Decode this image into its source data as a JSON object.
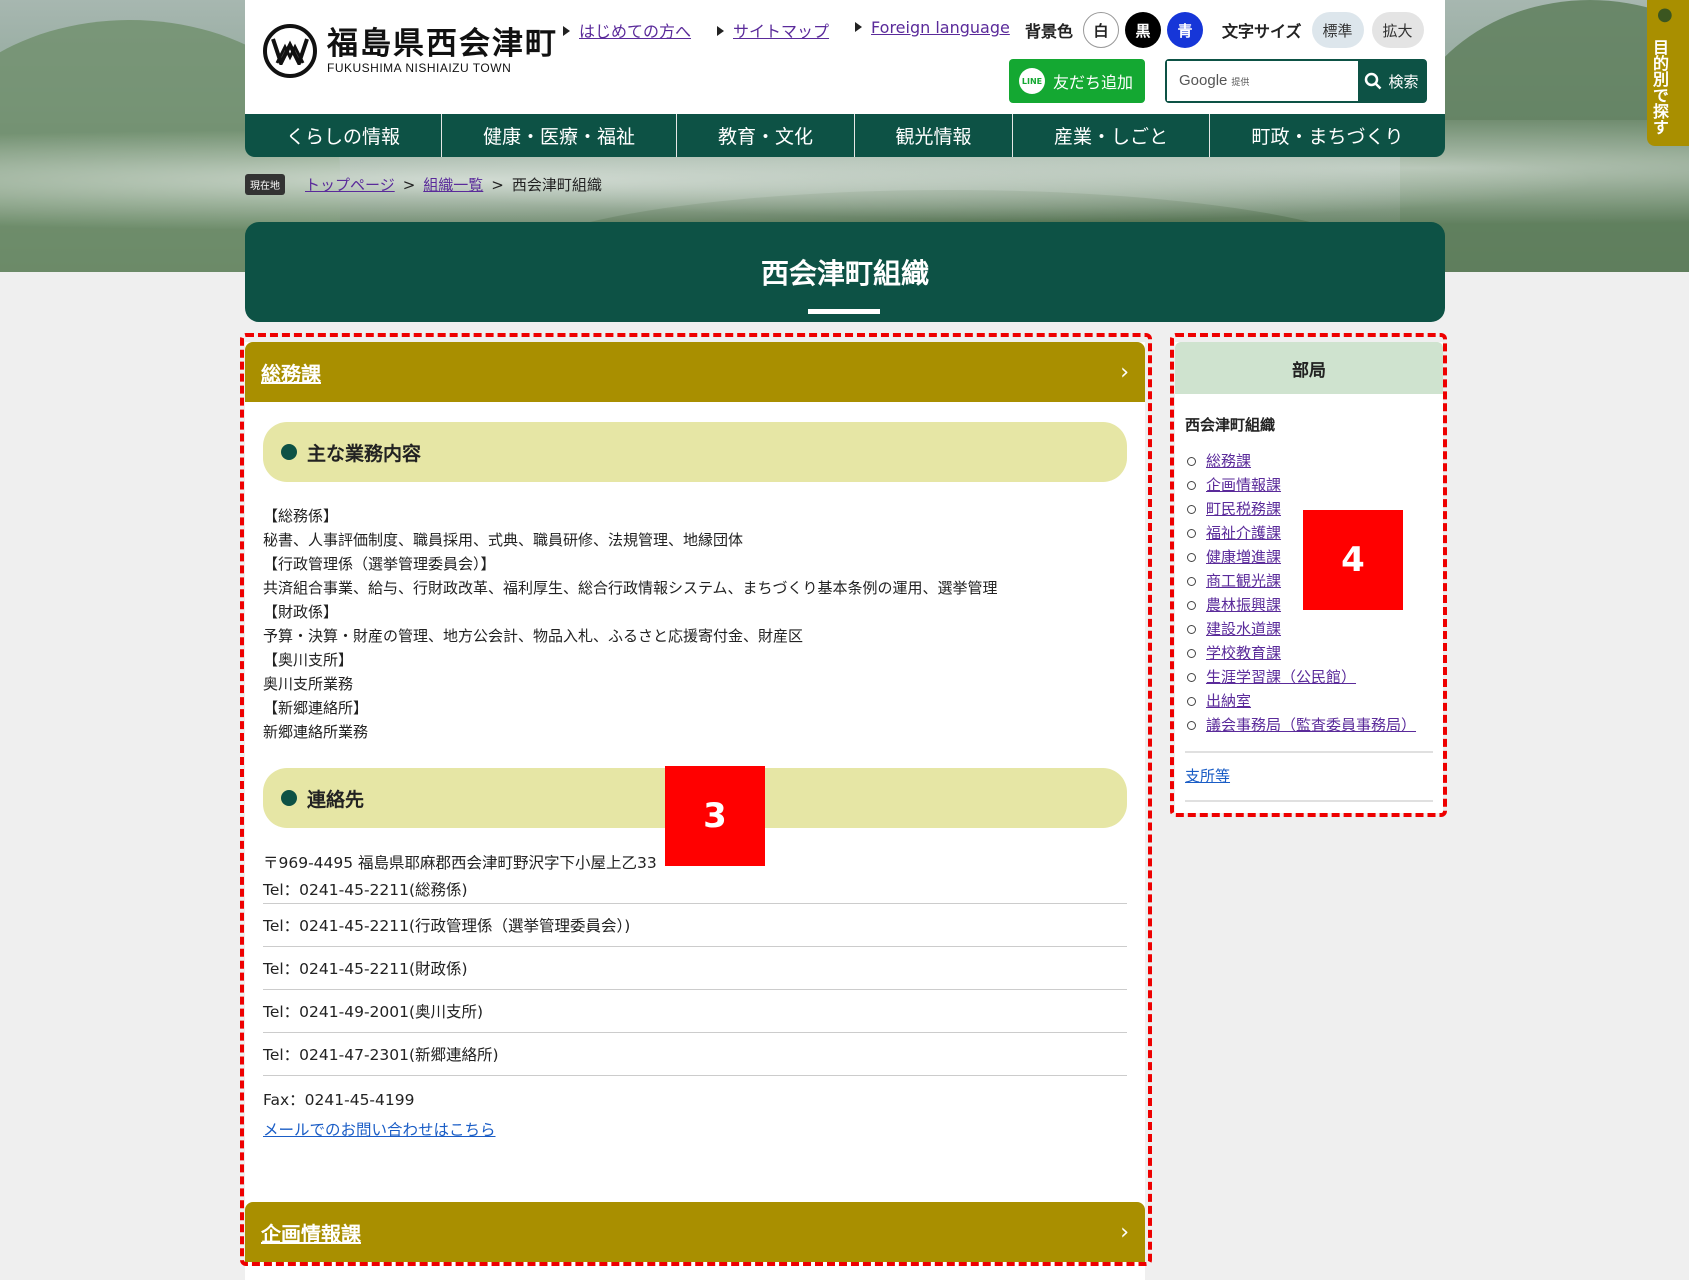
{
  "header": {
    "logo_ja": "福島県西会津町",
    "logo_en": "FUKUSHIMA NISHIAIZU TOWN",
    "links": [
      "はじめての方へ",
      "サイトマップ",
      "Foreign language"
    ],
    "bgcolor_label": "背景色",
    "bgcolor_options": [
      "白",
      "黒",
      "青"
    ],
    "fontsize_label": "文字サイズ",
    "fontsize_standard": "標準",
    "fontsize_large": "拡大",
    "line_button": "友だち追加",
    "line_icon": "LINE",
    "search_brand": "Google",
    "search_brand_sub": "提供",
    "search_button": "検索"
  },
  "mainnav": [
    "くらしの情報",
    "健康・医療・福祉",
    "教育・文化",
    "観光情報",
    "産業・しごと",
    "町政・まちづくり"
  ],
  "side_tab": "目的別で探す",
  "breadcrumb": {
    "here": "現在地",
    "top": "トップページ",
    "list": "組織一覧",
    "current": "西会津町組織"
  },
  "page_title": "西会津町組織",
  "main": {
    "dept_name": "総務課",
    "duties_heading": "主な業務内容",
    "duties": [
      "【総務係】",
      "秘書、人事評価制度、職員採用、式典、職員研修、法規管理、地縁団体",
      "【行政管理係（選挙管理委員会）】",
      "共済組合事業、給与、行財政改革、福利厚生、総合行政情報システム、まちづくり基本条例の運用、選挙管理",
      "【財政係】",
      "予算・決算・財産の管理、地方公会計、物品入札、ふるさと応援寄付金、財産区",
      "【奥川支所】",
      "奥川支所業務",
      "【新郷連絡所】",
      "新郷連絡所業務"
    ],
    "contact_heading": "連絡先",
    "address": "〒969-4495 福島県耶麻郡西会津町野沢字下小屋上乙33",
    "tels": [
      "Tel：0241-45-2211(総務係)",
      "Tel：0241-45-2211(行政管理係（選挙管理委員会）)",
      "Tel：0241-45-2211(財政係)",
      "Tel：0241-49-2001(奥川支所)",
      "Tel：0241-47-2301(新郷連絡所)"
    ],
    "fax": "Fax：0241-45-4199",
    "mail_link": "メールでのお問い合わせはこちら",
    "next_dept": "企画情報課"
  },
  "sidebar": {
    "heading": "部局",
    "subheading": "西会津町組織",
    "items": [
      "総務課",
      "企画情報課",
      "町民税務課",
      "福祉介護課",
      "健康増進課",
      "商工観光課",
      "農林振興課",
      "建設水道課",
      "学校教育課",
      "生涯学習課（公民館）",
      "出納室",
      "議会事務局（監査委員事務局）"
    ],
    "branch": "支所等"
  },
  "annotations": {
    "marker3": "3",
    "marker4": "4"
  }
}
